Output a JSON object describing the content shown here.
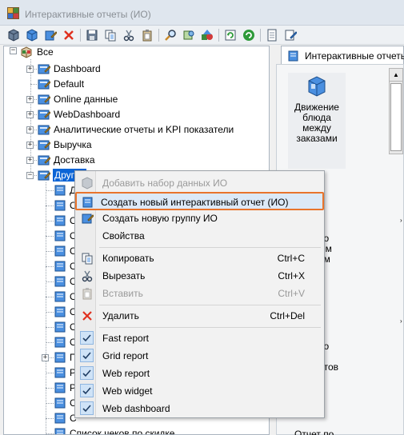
{
  "window": {
    "title": "Интерактивные отчеты (ИО)"
  },
  "toolbar": {
    "buttons": [
      "box-icon",
      "box-blue-icon",
      "report-edit-icon",
      "delete-icon",
      "save-icon",
      "copy-icon",
      "cut-icon",
      "paste-icon",
      "search-icon",
      "filter-icon",
      "shapes-icon",
      "refresh-icon",
      "refresh-green-icon",
      "document-icon",
      "document-edit-icon"
    ]
  },
  "tree": {
    "root": "Все",
    "items": [
      {
        "label": "Dashboard",
        "expandable": true
      },
      {
        "label": "Default",
        "expandable": false
      },
      {
        "label": "Online данные",
        "expandable": true
      },
      {
        "label": "WebDashboard",
        "expandable": true
      },
      {
        "label": "Аналитические отчеты и KPI показатели",
        "expandable": true
      },
      {
        "label": "Выручка",
        "expandable": true
      },
      {
        "label": "Доставка",
        "expandable": true
      },
      {
        "label": "Другие",
        "expandable": true,
        "expanded": true,
        "selected": true
      }
    ],
    "children": [
      {
        "label": "Д"
      },
      {
        "label": "О"
      },
      {
        "label": "О"
      },
      {
        "label": "О"
      },
      {
        "label": "О"
      },
      {
        "label": "О"
      },
      {
        "label": "О"
      },
      {
        "label": "О"
      },
      {
        "label": "О"
      },
      {
        "label": "О"
      },
      {
        "label": "О"
      },
      {
        "label": "П",
        "expandable": true
      },
      {
        "label": "Р"
      },
      {
        "label": "Р"
      },
      {
        "label": "С"
      },
      {
        "label": "С"
      },
      {
        "label": "Список чеков по скидке"
      }
    ]
  },
  "right_panel": {
    "tab_label": "Интерактивные отчеты",
    "cards": [
      {
        "label": "Движение блюда между заказами"
      },
      {
        "label": "Отчет по"
      }
    ],
    "partial_texts": [
      "по",
      "ым",
      "ам",
      "по",
      "нтов"
    ]
  },
  "context_menu": {
    "items": [
      {
        "label": "Добавить набор данных ИО",
        "disabled": true,
        "icon": "box-gray-icon"
      },
      {
        "label": "Создать новый интерактивный отчет (ИО)",
        "highlighted": true,
        "icon": "report-new-icon"
      },
      {
        "label": "Создать новую группу ИО",
        "icon": "group-new-icon"
      },
      {
        "label": "Свойства"
      },
      {
        "label": "Копировать",
        "shortcut": "Ctrl+C",
        "icon": "copy-icon"
      },
      {
        "label": "Вырезать",
        "shortcut": "Ctrl+X",
        "icon": "cut-icon"
      },
      {
        "label": "Вставить",
        "shortcut": "Ctrl+V",
        "disabled": true,
        "icon": "paste-icon"
      },
      {
        "label": "Удалить",
        "shortcut": "Ctrl+Del",
        "icon": "delete-icon"
      },
      {
        "label": "Fast report",
        "checked": true
      },
      {
        "label": "Grid report",
        "checked": true
      },
      {
        "label": "Web report",
        "checked": true
      },
      {
        "label": "Web widget",
        "checked": true
      },
      {
        "label": "Web dashboard",
        "checked": true
      }
    ]
  },
  "colors": {
    "selection": "#0a64d6",
    "highlight_border": "#e8742c",
    "highlight_bg": "#dce9f7",
    "delete_red": "#e0311f"
  }
}
